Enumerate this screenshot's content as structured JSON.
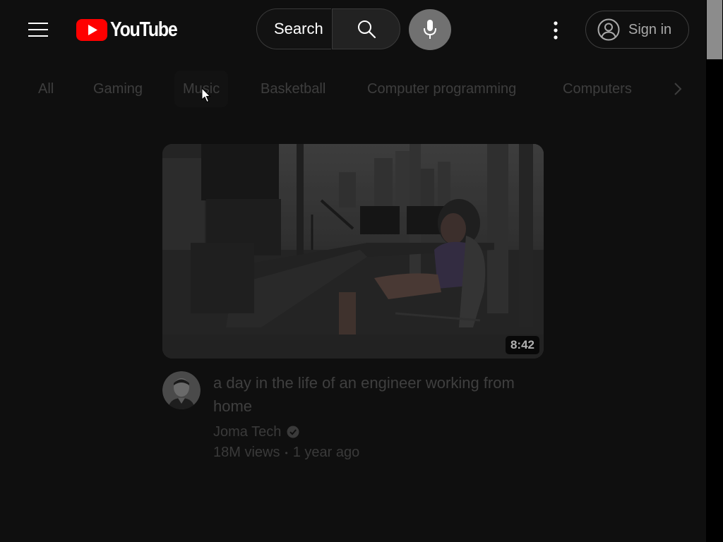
{
  "header": {
    "logo_text": "YouTube",
    "search": {
      "placeholder": "Search"
    },
    "signin_label": "Sign in"
  },
  "chips": [
    {
      "label": "All"
    },
    {
      "label": "Gaming"
    },
    {
      "label": "Music"
    },
    {
      "label": "Basketball"
    },
    {
      "label": "Computer programming"
    },
    {
      "label": "Computers"
    }
  ],
  "video": {
    "title": "a day in the life of an engineer working from home",
    "channel": "Joma Tech",
    "views": "18M views",
    "separator": "•",
    "age": "1 year ago",
    "duration": "8:42"
  },
  "icons": {
    "menu": "hamburger-menu-icon",
    "search": "search-icon",
    "mic": "microphone-icon",
    "more": "more-vert-icon",
    "account": "account-circle-icon",
    "next": "chevron-right-icon",
    "verified": "verified-check-icon"
  },
  "colors": {
    "background": "#0f0f0f",
    "brand_red": "#ff0000",
    "search_button": "#222222",
    "mic_button": "#717171",
    "scroll_thumb": "#8c8c8c"
  }
}
